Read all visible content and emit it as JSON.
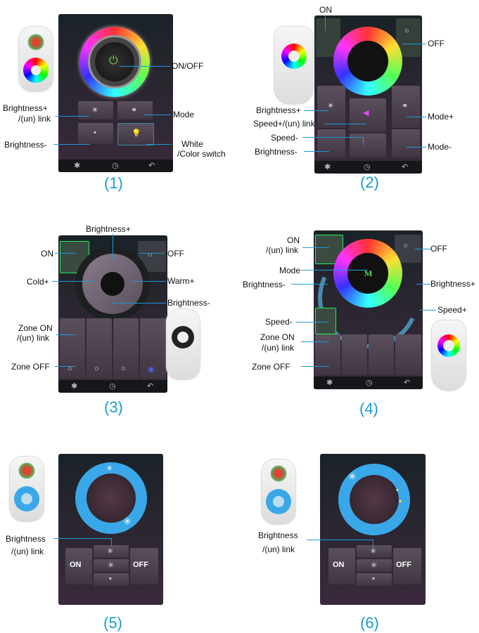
{
  "panels": [
    {
      "caption": "(1)",
      "labels": {
        "onoff": "ON/OFF",
        "brightness_plus": "Brightness+",
        "link": "/(un) link",
        "mode": "Mode",
        "brightness_minus": "Brightness-",
        "white": "White",
        "color_switch": "/Color switch"
      }
    },
    {
      "caption": "(2)",
      "labels": {
        "on": "ON",
        "off": "OFF",
        "brightness_plus": "Brightness+",
        "speed_plus": "Speed+/(un) link",
        "mode_plus": "Mode+",
        "speed_minus": "Speed-",
        "brightness_minus": "Brightness-",
        "mode_minus": "Mode-"
      }
    },
    {
      "caption": "(3)",
      "labels": {
        "brightness_plus": "Brightness+",
        "on": "ON",
        "off": "OFF",
        "cold": "Cold+",
        "warm": "Warm+",
        "brightness_minus": "Brightness-",
        "zone_on": "Zone ON",
        "link": "/(un) link",
        "zone_off": "Zone OFF"
      }
    },
    {
      "caption": "(4)",
      "labels": {
        "on": "ON",
        "on_link": "/(un) link",
        "off": "OFF",
        "mode": "Mode",
        "brightness_minus": "Brightness-",
        "brightness_plus": "Brightness+",
        "speed_plus": "Speed+",
        "speed_minus": "Speed-",
        "zone_on": "Zone ON",
        "zone_link": "/(un) link",
        "zone_off": "Zone OFF",
        "m_glyph": "M"
      }
    },
    {
      "caption": "(5)",
      "labels": {
        "brightness": "Brightness",
        "link": "/(un) link",
        "on_btn": "ON",
        "off_btn": "OFF"
      }
    },
    {
      "caption": "(6)",
      "labels": {
        "brightness": "Brightness",
        "link": "/(un) link",
        "on_btn": "ON",
        "off_btn": "OFF"
      }
    }
  ],
  "colors": {
    "accent": "#1a9ad6",
    "zone_glow": "#3a4cff",
    "power_green": "#6ad04a",
    "cct_blue": "#3aa8e8"
  }
}
